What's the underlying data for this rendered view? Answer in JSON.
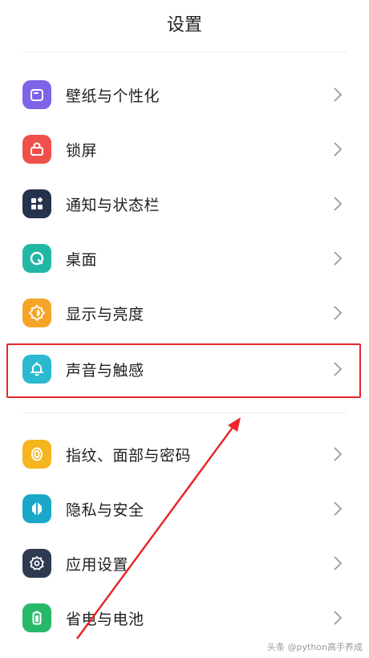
{
  "header": {
    "title": "设置"
  },
  "items": [
    {
      "label": "壁纸与个性化",
      "icon": "wallpaper-icon",
      "color": "#7f63e8"
    },
    {
      "label": "锁屏",
      "icon": "lock-icon",
      "color": "#f0504c"
    },
    {
      "label": "通知与状态栏",
      "icon": "notification-icon",
      "color": "#25324b"
    },
    {
      "label": "桌面",
      "icon": "desktop-icon",
      "color": "#20b8a4"
    },
    {
      "label": "显示与亮度",
      "icon": "brightness-icon",
      "color": "#f4a528"
    },
    {
      "label": "声音与触感",
      "icon": "bell-icon",
      "color": "#2bb9d0"
    },
    {
      "label": "指纹、面部与密码",
      "icon": "fingerprint-icon",
      "color": "#f5b51e"
    },
    {
      "label": "隐私与安全",
      "icon": "privacy-icon",
      "color": "#1ba8c8"
    },
    {
      "label": "应用设置",
      "icon": "gear-icon",
      "color": "#2e3a52"
    },
    {
      "label": "省电与电池",
      "icon": "battery-icon",
      "color": "#27b86a"
    }
  ],
  "highlight": {
    "item": "声音与触感",
    "color": "#e8262b"
  },
  "watermark": "头条 @python高手养成"
}
